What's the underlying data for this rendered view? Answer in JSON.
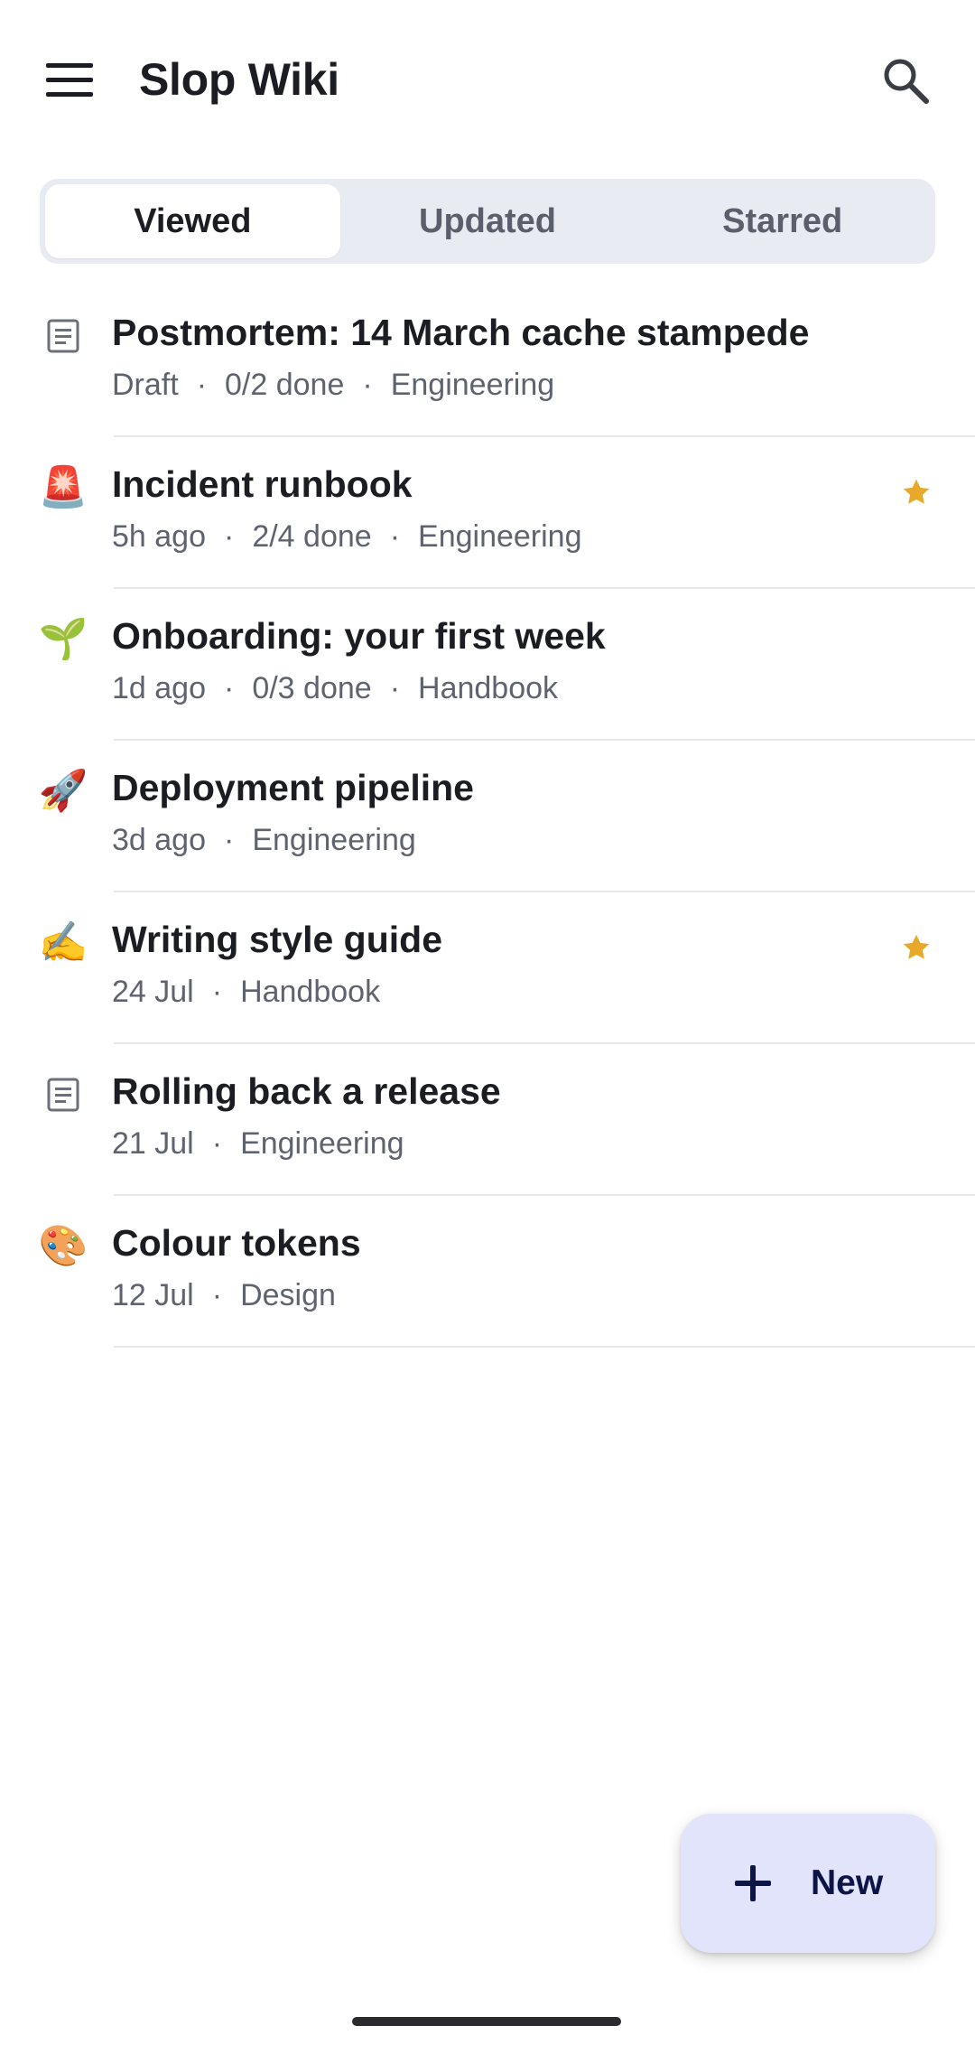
{
  "app": {
    "title": "Slop Wiki",
    "menu_icon": "hamburger-menu-icon",
    "search_icon": "search-icon"
  },
  "tabs": [
    {
      "label": "Viewed",
      "active": true
    },
    {
      "label": "Updated",
      "active": false
    },
    {
      "label": "Starred",
      "active": false
    }
  ],
  "pages": [
    {
      "icon": "document-icon",
      "emoji": "",
      "title": "Postmortem: 14 March cache stampede",
      "meta": [
        "Draft",
        "0/2 done",
        "Engineering"
      ],
      "starred": false
    },
    {
      "icon": "siren-icon",
      "emoji": "🚨",
      "title": "Incident runbook",
      "meta": [
        "5h ago",
        "2/4 done",
        "Engineering"
      ],
      "starred": true
    },
    {
      "icon": "seedling-icon",
      "emoji": "🌱",
      "title": "Onboarding: your first week",
      "meta": [
        "1d ago",
        "0/3 done",
        "Handbook"
      ],
      "starred": false
    },
    {
      "icon": "rocket-icon",
      "emoji": "🚀",
      "title": "Deployment pipeline",
      "meta": [
        "3d ago",
        "Engineering"
      ],
      "starred": false
    },
    {
      "icon": "writing-hand-icon",
      "emoji": "✍️",
      "title": "Writing style guide",
      "meta": [
        "24 Jul",
        "Handbook"
      ],
      "starred": true
    },
    {
      "icon": "document-icon",
      "emoji": "",
      "title": "Rolling back a release",
      "meta": [
        "21 Jul",
        "Engineering"
      ],
      "starred": false
    },
    {
      "icon": "palette-icon",
      "emoji": "🎨",
      "title": "Colour tokens",
      "meta": [
        "12 Jul",
        "Design"
      ],
      "starred": false
    }
  ],
  "fab": {
    "label": "New",
    "icon": "plus-icon"
  },
  "colors": {
    "star": "#e8a92a",
    "fab_bg": "#e2e4fb",
    "tabs_bg": "#e9ebf3"
  }
}
